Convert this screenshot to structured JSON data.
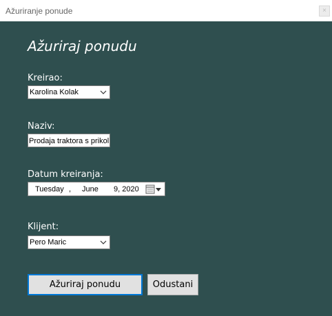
{
  "window": {
    "title": "Ažuriranje ponude",
    "close_symbol": "×"
  },
  "form": {
    "heading": "Ažuriraj ponudu",
    "kreirao": {
      "label": "Kreirao:",
      "value": "Karolina Kolak"
    },
    "naziv": {
      "label": "Naziv:",
      "value": "Prodaja traktora s prikolic"
    },
    "datum": {
      "label": "Datum kreiranja:",
      "weekday": "Tuesday",
      "comma": ",",
      "month": "June",
      "day_year": "9, 2020"
    },
    "klijent": {
      "label": "Klijent:",
      "value": "Pero Maric"
    }
  },
  "buttons": {
    "update_label": "Ažuriraj ponudu",
    "cancel_label": "Odustani"
  },
  "icons": {
    "dropdown": "chevron-down-icon",
    "calendar": "calendar-icon"
  },
  "colors": {
    "background": "#2f4f4f",
    "focus_border": "#0078d7"
  }
}
